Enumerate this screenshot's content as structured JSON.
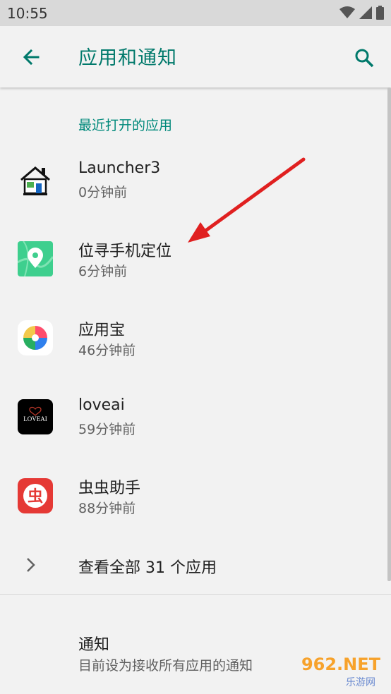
{
  "status_bar": {
    "time": "10:55",
    "icons": [
      "wifi-icon",
      "signal-icon",
      "battery-icon"
    ]
  },
  "toolbar": {
    "title": "应用和通知",
    "back_icon": "arrow-left-icon",
    "search_icon": "search-icon"
  },
  "recent": {
    "header": "最近打开的应用",
    "apps": [
      {
        "name": "Launcher3",
        "time": "0分钟前",
        "icon": "launcher-house-icon"
      },
      {
        "name": "位寻手机定位",
        "time": "6分钟前",
        "icon": "location-pin-icon"
      },
      {
        "name": "应用宝",
        "time": "46分钟前",
        "icon": "yingyongbao-icon"
      },
      {
        "name": "loveai",
        "time": "59分钟前",
        "icon": "loveai-logo-icon",
        "logo_text": "LOVEAI"
      },
      {
        "name": "虫虫助手",
        "time": "88分钟前",
        "icon": "chongchong-icon",
        "logo_text": "虫"
      }
    ]
  },
  "see_all": {
    "label": "查看全部 31 个应用"
  },
  "notifications": {
    "title": "通知",
    "subtitle": "目前设为接收所有应用的通知"
  },
  "watermark": {
    "text": "962.NET",
    "sub": "乐游网"
  },
  "colors": {
    "accent": "#00796b",
    "header_accent": "#00897b",
    "arrow": "#e02020"
  }
}
